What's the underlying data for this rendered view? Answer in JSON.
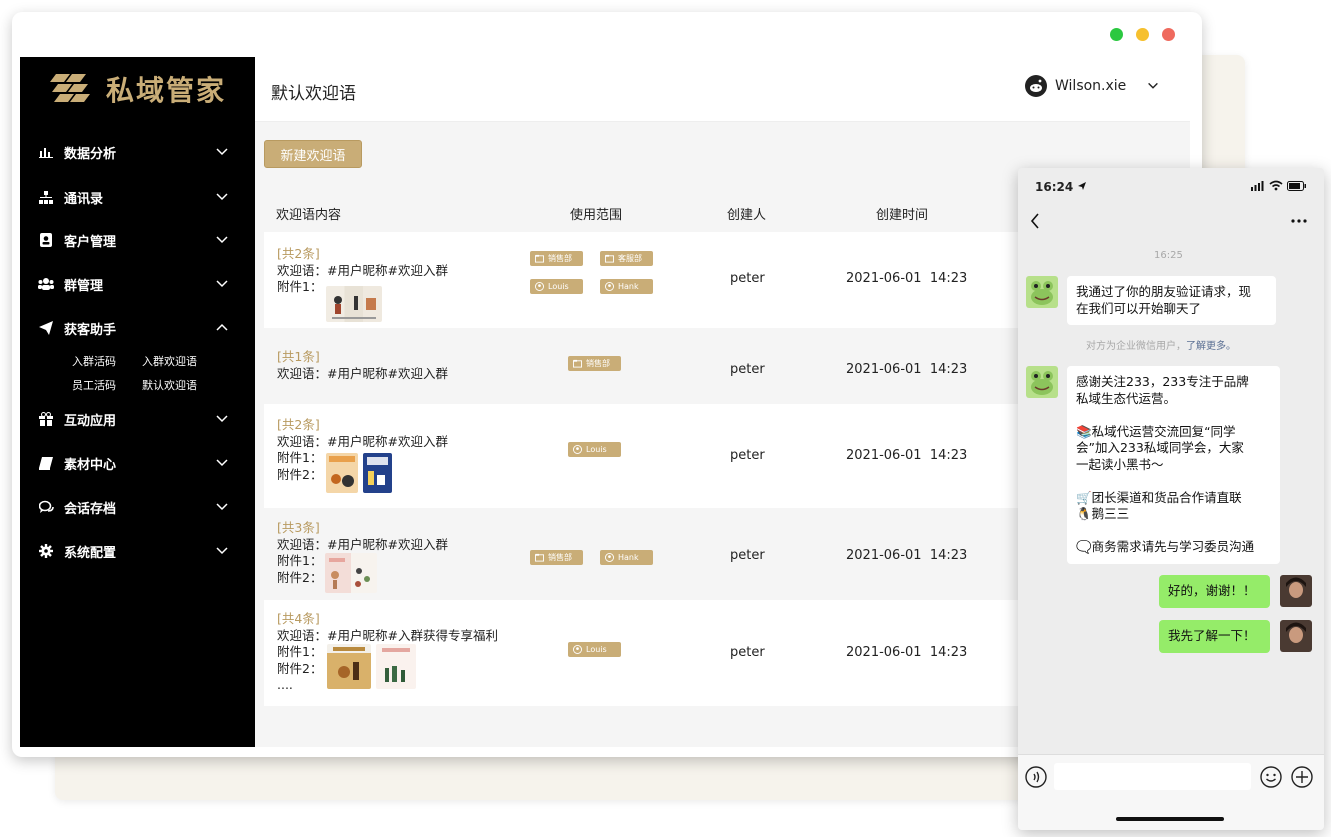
{
  "app": {
    "logo_text": "私域管家",
    "page_title": "默认欢迎语",
    "user_name": "Wilson.xie",
    "colors": {
      "accent": "#c9ad77",
      "sidebar": "#000000",
      "bubble_me": "#95ec69"
    }
  },
  "sidebar": {
    "items": [
      {
        "label": "数据分析",
        "icon": "bar-chart-icon"
      },
      {
        "label": "通讯录",
        "icon": "org-chart-icon"
      },
      {
        "label": "客户管理",
        "icon": "contact-card-icon"
      },
      {
        "label": "群管理",
        "icon": "group-icon"
      },
      {
        "label": "获客助手",
        "icon": "paper-plane-icon"
      },
      {
        "label": "互动应用",
        "icon": "gift-icon"
      },
      {
        "label": "素材中心",
        "icon": "book-icon"
      },
      {
        "label": "会话存档",
        "icon": "chat-icon"
      },
      {
        "label": "系统配置",
        "icon": "gear-icon"
      }
    ],
    "sub": [
      "入群活码",
      "入群欢迎语",
      "员工活码",
      "默认欢迎语"
    ]
  },
  "toolbar": {
    "new_label": "新建欢迎语"
  },
  "table": {
    "headers": [
      "欢迎语内容",
      "使用范围",
      "创建人",
      "创建时间"
    ],
    "rows": [
      {
        "count": "[共2条]",
        "lines": [
          "欢迎语：#用户昵称#欢迎入群",
          "附件1："
        ],
        "tags": [
          "销售部",
          "客服部",
          "Louis",
          "Hank"
        ],
        "creator": "peter",
        "date": "2021-06-01",
        "time": "14:23"
      },
      {
        "count": "[共1条]",
        "lines": [
          "欢迎语：#用户昵称#欢迎入群"
        ],
        "tags": [
          "销售部"
        ],
        "creator": "peter",
        "date": "2021-06-01",
        "time": "14:23"
      },
      {
        "count": "[共2条]",
        "lines": [
          "欢迎语：#用户昵称#欢迎入群",
          "附件1：",
          "附件2："
        ],
        "tags": [
          "Louis"
        ],
        "creator": "peter",
        "date": "2021-06-01",
        "time": "14:23"
      },
      {
        "count": "[共3条]",
        "lines": [
          "欢迎语：#用户昵称#欢迎入群",
          "附件1：",
          "附件2："
        ],
        "tags": [
          "销售部",
          "Hank"
        ],
        "creator": "peter",
        "date": "2021-06-01",
        "time": "14:23"
      },
      {
        "count": "[共4条]",
        "lines": [
          "欢迎语：#用户昵称#入群获得专享福利",
          "附件1：",
          "附件2：",
          "...."
        ],
        "tags": [
          "Louis"
        ],
        "creator": "peter",
        "date": "2021-06-01",
        "time": "14:23"
      }
    ]
  },
  "phone": {
    "time": "16:24",
    "chat_time": "16:25",
    "msg1": [
      "我通过了你的朋友验证请求，现",
      "在我们可以开始聊天了"
    ],
    "sys_text": "对方为企业微信用户，",
    "sys_link": "了解更多。",
    "msg2": [
      "感谢关注233，233专注于品牌",
      "私域生态代运营。",
      "",
      "📚私域代运营交流回复“同学",
      "会”加入233私域同学会，大家",
      "一起读小黑书～",
      "",
      "🛒团长渠道和货品合作请直联",
      "🐧鹅三三",
      "",
      "🗨️商务需求请先与学习委员沟通"
    ],
    "reply1": "好的，谢谢！！",
    "reply2": "我先了解一下！"
  }
}
